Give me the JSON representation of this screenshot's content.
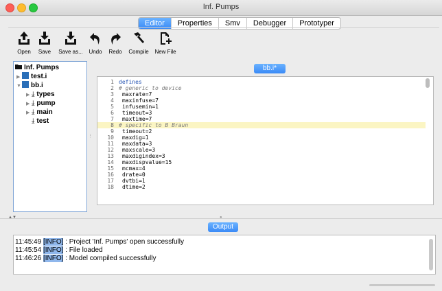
{
  "window": {
    "title": "Inf. Pumps"
  },
  "tabs": [
    {
      "label": "Editor",
      "active": true
    },
    {
      "label": "Properties",
      "active": false
    },
    {
      "label": "Smv",
      "active": false
    },
    {
      "label": "Debugger",
      "active": false
    },
    {
      "label": "Prototyper",
      "active": false
    }
  ],
  "toolbar": {
    "open": "Open",
    "save": "Save",
    "save_as": "Save as...",
    "undo": "Undo",
    "redo": "Redo",
    "compile": "Compile",
    "new_file": "New File"
  },
  "tree": {
    "root": "Inf. Pumps",
    "items": [
      "test.i",
      "bb.i",
      "types",
      "pump",
      "main",
      "test"
    ]
  },
  "editor": {
    "file_tab": "bb.i*",
    "lines": [
      {
        "n": "1",
        "text": "defines"
      },
      {
        "n": "2",
        "text": "# generic to device"
      },
      {
        "n": "3",
        "text": "maxrate=7"
      },
      {
        "n": "4",
        "text": "maxinfuse=7"
      },
      {
        "n": "5",
        "text": "infusemin=1"
      },
      {
        "n": "6",
        "text": "timeout=3"
      },
      {
        "n": "7",
        "text": "maxtime=7"
      },
      {
        "n": "8",
        "text": "# specific to B Braun"
      },
      {
        "n": "9",
        "text": "timeout=2"
      },
      {
        "n": "10",
        "text": "maxdig=1"
      },
      {
        "n": "11",
        "text": "maxdata=3"
      },
      {
        "n": "12",
        "text": "maxscale=3"
      },
      {
        "n": "13",
        "text": "maxdigindex=3"
      },
      {
        "n": "14",
        "text": "maxdispvalue=15"
      },
      {
        "n": "15",
        "text": "mcmax=4"
      },
      {
        "n": "16",
        "text": "drate=0"
      },
      {
        "n": "17",
        "text": "dvtbi=1"
      },
      {
        "n": "18",
        "text": "dtime=2"
      }
    ]
  },
  "output": {
    "tab": "Output",
    "lines": [
      {
        "time": "11:45:49",
        "tag": "[INFO]",
        "msg": ": Project 'Inf. Pumps' open successfully"
      },
      {
        "time": "11:45:54",
        "tag": "[INFO]",
        "msg": ": File loaded"
      },
      {
        "time": "11:46:26",
        "tag": "[INFO]",
        "msg": ": Model compiled successfully"
      }
    ]
  },
  "colors": {
    "accent": "#3a8af6",
    "highlight_line": "#fbf5c3",
    "info_tag": "#8fb7ec"
  }
}
